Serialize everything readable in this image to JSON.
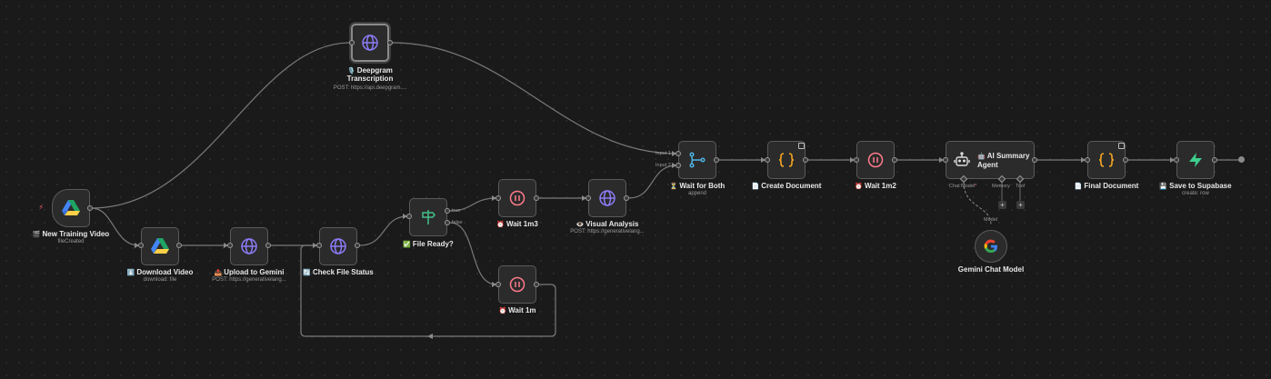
{
  "nodes": {
    "new_training_video": {
      "title": "New Training Video",
      "subtitle": "fileCreated",
      "icon": "google-drive-icon",
      "emoji": "🎬"
    },
    "download_video": {
      "title": "Download Video",
      "subtitle": "download: file",
      "icon": "google-drive-icon",
      "emoji": "⬇️"
    },
    "upload_to_gemini": {
      "title": "Upload to Gemini",
      "subtitle": "POST: https://generativelang...",
      "icon": "globe-icon",
      "emoji": "📤"
    },
    "check_file_status": {
      "title": "Check File Status",
      "subtitle": "",
      "icon": "globe-icon",
      "emoji": "🔄"
    },
    "file_ready": {
      "title": "File Ready?",
      "subtitle": "",
      "icon": "signpost-icon",
      "emoji": "✅",
      "true_label": "true",
      "false_label": "false"
    },
    "wait_1m3": {
      "title": "Wait 1m3",
      "subtitle": "",
      "icon": "pause-icon",
      "emoji": "⏰"
    },
    "wait_1m": {
      "title": "Wait 1m",
      "subtitle": "",
      "icon": "pause-icon",
      "emoji": "⏰"
    },
    "visual_analysis": {
      "title": "Visual Analysis",
      "subtitle": "POST: https://generativelang...",
      "icon": "globe-icon",
      "emoji": "👁️"
    },
    "deepgram": {
      "title_line1": "Deepgram",
      "title_line2": "Transcription",
      "subtitle": "POST: https://api.deepgram....",
      "icon": "globe-icon",
      "emoji": "🎙️"
    },
    "wait_for_both": {
      "title": "Wait for Both",
      "subtitle": "append",
      "icon": "merge-icon",
      "emoji": "⏳",
      "input1": "Input 1",
      "input2": "Input 2"
    },
    "create_document": {
      "title": "Create Document",
      "subtitle": "",
      "icon": "braces-icon",
      "emoji": "📄"
    },
    "wait_1m2": {
      "title": "Wait 1m2",
      "subtitle": "",
      "icon": "pause-icon",
      "emoji": "⏰"
    },
    "ai_summary_agent": {
      "title_line1": "AI Summary",
      "title_line2": "Agent",
      "icon": "robot-icon",
      "emoji": "🤖",
      "chat_model": "Chat Model",
      "memory": "Memory",
      "tool": "Tool"
    },
    "final_document": {
      "title": "Final Document",
      "subtitle": "",
      "icon": "braces-icon",
      "emoji": "📄"
    },
    "save_to_supabase": {
      "title": "Save to Supabase",
      "subtitle": "create: row",
      "icon": "supabase-icon",
      "emoji": "💾"
    },
    "gemini_chat_model": {
      "title": "Gemini Chat Model",
      "icon": "google-icon",
      "model_label": "Model"
    }
  },
  "colors": {
    "background": "#1a1a1a",
    "wire": "#7a7a7a",
    "globe": "#8b7cf6",
    "pause": "#ff7a8a",
    "braces": "#f5a623",
    "merge": "#4fb3e6",
    "signpost": "#44c08a",
    "supabase": "#3ecf8e"
  }
}
